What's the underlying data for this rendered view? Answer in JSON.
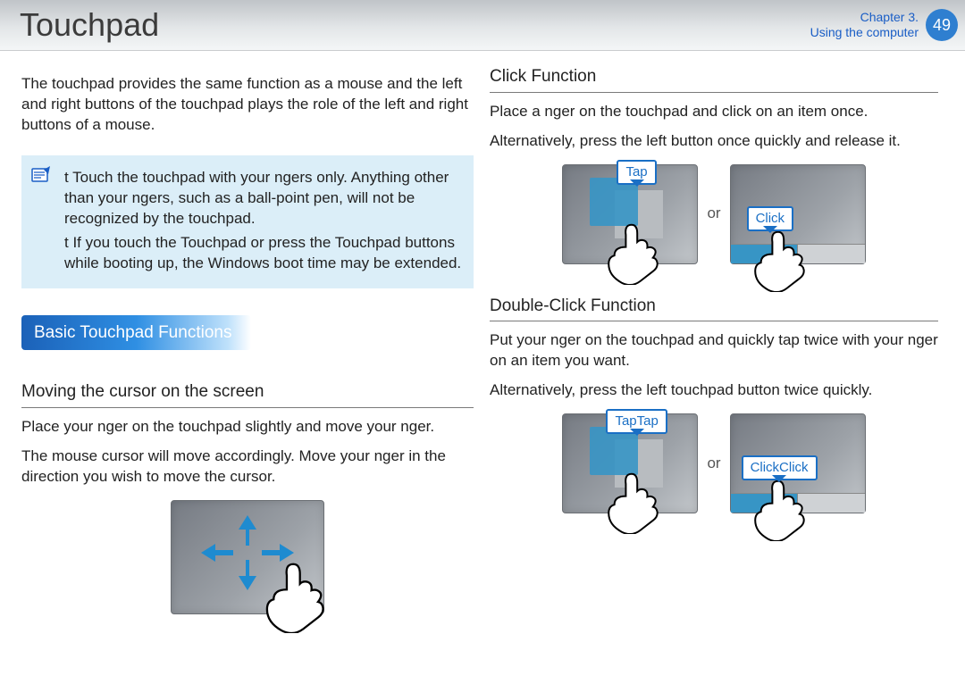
{
  "header": {
    "title": "Touchpad",
    "chapter_line1": "Chapter 3.",
    "chapter_line2": "Using the computer",
    "page_number": "49"
  },
  "left": {
    "intro": "The touchpad provides the same function as a mouse and the left and right buttons of the touchpad plays the role of the left and right buttons of a mouse.",
    "note": {
      "bullets": [
        "t  Touch the touchpad with your  ngers only. Anything other than your  ngers, such as a ball-point pen, will not be recognized by the touchpad.",
        "t  If you touch the Touchpad or press the Touchpad buttons while booting up, the Windows boot time may be extended."
      ]
    },
    "section_title": "Basic Touchpad Functions",
    "subhead_move": "Moving the cursor on the screen",
    "move_body1": "Place your  nger on the touchpad slightly and move your  nger.",
    "move_body2": "The mouse cursor will move accordingly. Move your  nger in the direction you wish to move the cursor."
  },
  "right": {
    "click_heading": "Click Function",
    "click_body1": "Place a  nger on the touchpad and click on an item once.",
    "click_body2": "Alternatively, press the left button once quickly and release it.",
    "tap_label": "Tap",
    "click_label": "Click",
    "or_label": "or",
    "dbl_heading": "Double-Click Function",
    "dbl_body1": "Put your  nger on the touchpad and quickly tap twice with your  nger on an item you want.",
    "dbl_body2": "Alternatively, press the left touchpad button twice quickly.",
    "taptap_label": "TapTap",
    "clickclick_label": "ClickClick"
  }
}
